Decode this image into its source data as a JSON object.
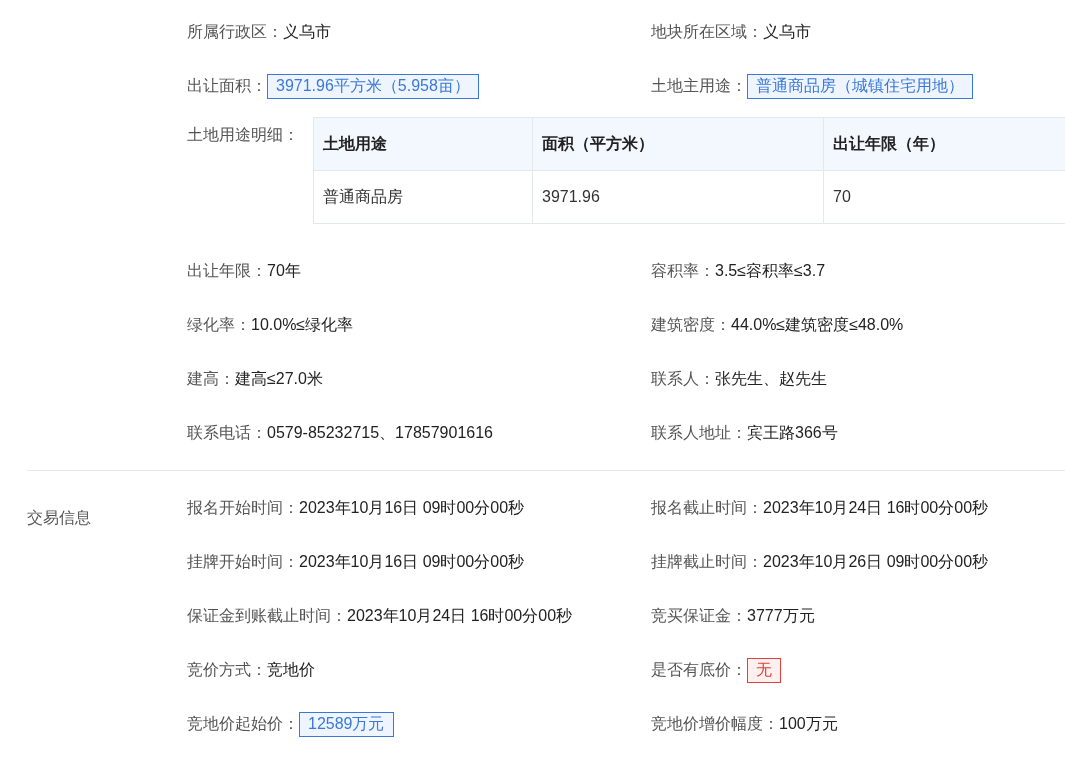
{
  "land_info": {
    "fields_top": [
      {
        "label": "所属行政区：",
        "value": "义乌市",
        "kind": "plain"
      },
      {
        "label": "地块所在区域：",
        "value": "义乌市",
        "kind": "plain"
      },
      {
        "label": "出让面积：",
        "value": "3971.96平方米（5.958亩）",
        "kind": "blue_tag"
      },
      {
        "label": "土地主用途：",
        "value": "普通商品房（城镇住宅用地）",
        "kind": "blue_tag"
      }
    ],
    "land_use_table": {
      "label": "土地用途明细：",
      "columns": [
        "土地用途",
        "面积（平方米）",
        "出让年限（年）"
      ],
      "rows": [
        [
          "普通商品房",
          "3971.96",
          "70"
        ]
      ]
    },
    "fields_bottom": [
      {
        "label": "出让年限：",
        "value": "70年",
        "kind": "plain"
      },
      {
        "label": "容积率：",
        "value": "3.5≤容积率≤3.7",
        "kind": "plain"
      },
      {
        "label": "绿化率：",
        "value": "10.0%≤绿化率",
        "kind": "plain"
      },
      {
        "label": "建筑密度：",
        "value": "44.0%≤建筑密度≤48.0%",
        "kind": "plain"
      },
      {
        "label": "建高：",
        "value": "建高≤27.0米",
        "kind": "plain"
      },
      {
        "label": "联系人：",
        "value": "张先生、赵先生",
        "kind": "plain"
      },
      {
        "label": "联系电话：",
        "value": "0579-85232715、17857901616",
        "kind": "plain"
      },
      {
        "label": "联系人地址：",
        "value": "宾王路366号",
        "kind": "plain"
      }
    ]
  },
  "trade_info": {
    "title": "交易信息",
    "fields": [
      {
        "label": "报名开始时间：",
        "value": "2023年10月16日 09时00分00秒",
        "kind": "plain"
      },
      {
        "label": "报名截止时间：",
        "value": "2023年10月24日 16时00分00秒",
        "kind": "plain"
      },
      {
        "label": "挂牌开始时间：",
        "value": "2023年10月16日 09时00分00秒",
        "kind": "plain"
      },
      {
        "label": "挂牌截止时间：",
        "value": "2023年10月26日 09时00分00秒",
        "kind": "plain"
      },
      {
        "label": "保证金到账截止时间：",
        "value": "2023年10月24日 16时00分00秒",
        "kind": "plain"
      },
      {
        "label": "竞买保证金：",
        "value": "3777万元",
        "kind": "plain"
      },
      {
        "label": "竞价方式：",
        "value": "竞地价",
        "kind": "plain"
      },
      {
        "label": "是否有底价：",
        "value": "无",
        "kind": "red_tag"
      },
      {
        "label": "竞地价起始价：",
        "value": "12589万元",
        "kind": "blue_tag"
      },
      {
        "label": "竞地价增价幅度：",
        "value": "100万元",
        "kind": "plain"
      }
    ]
  }
}
